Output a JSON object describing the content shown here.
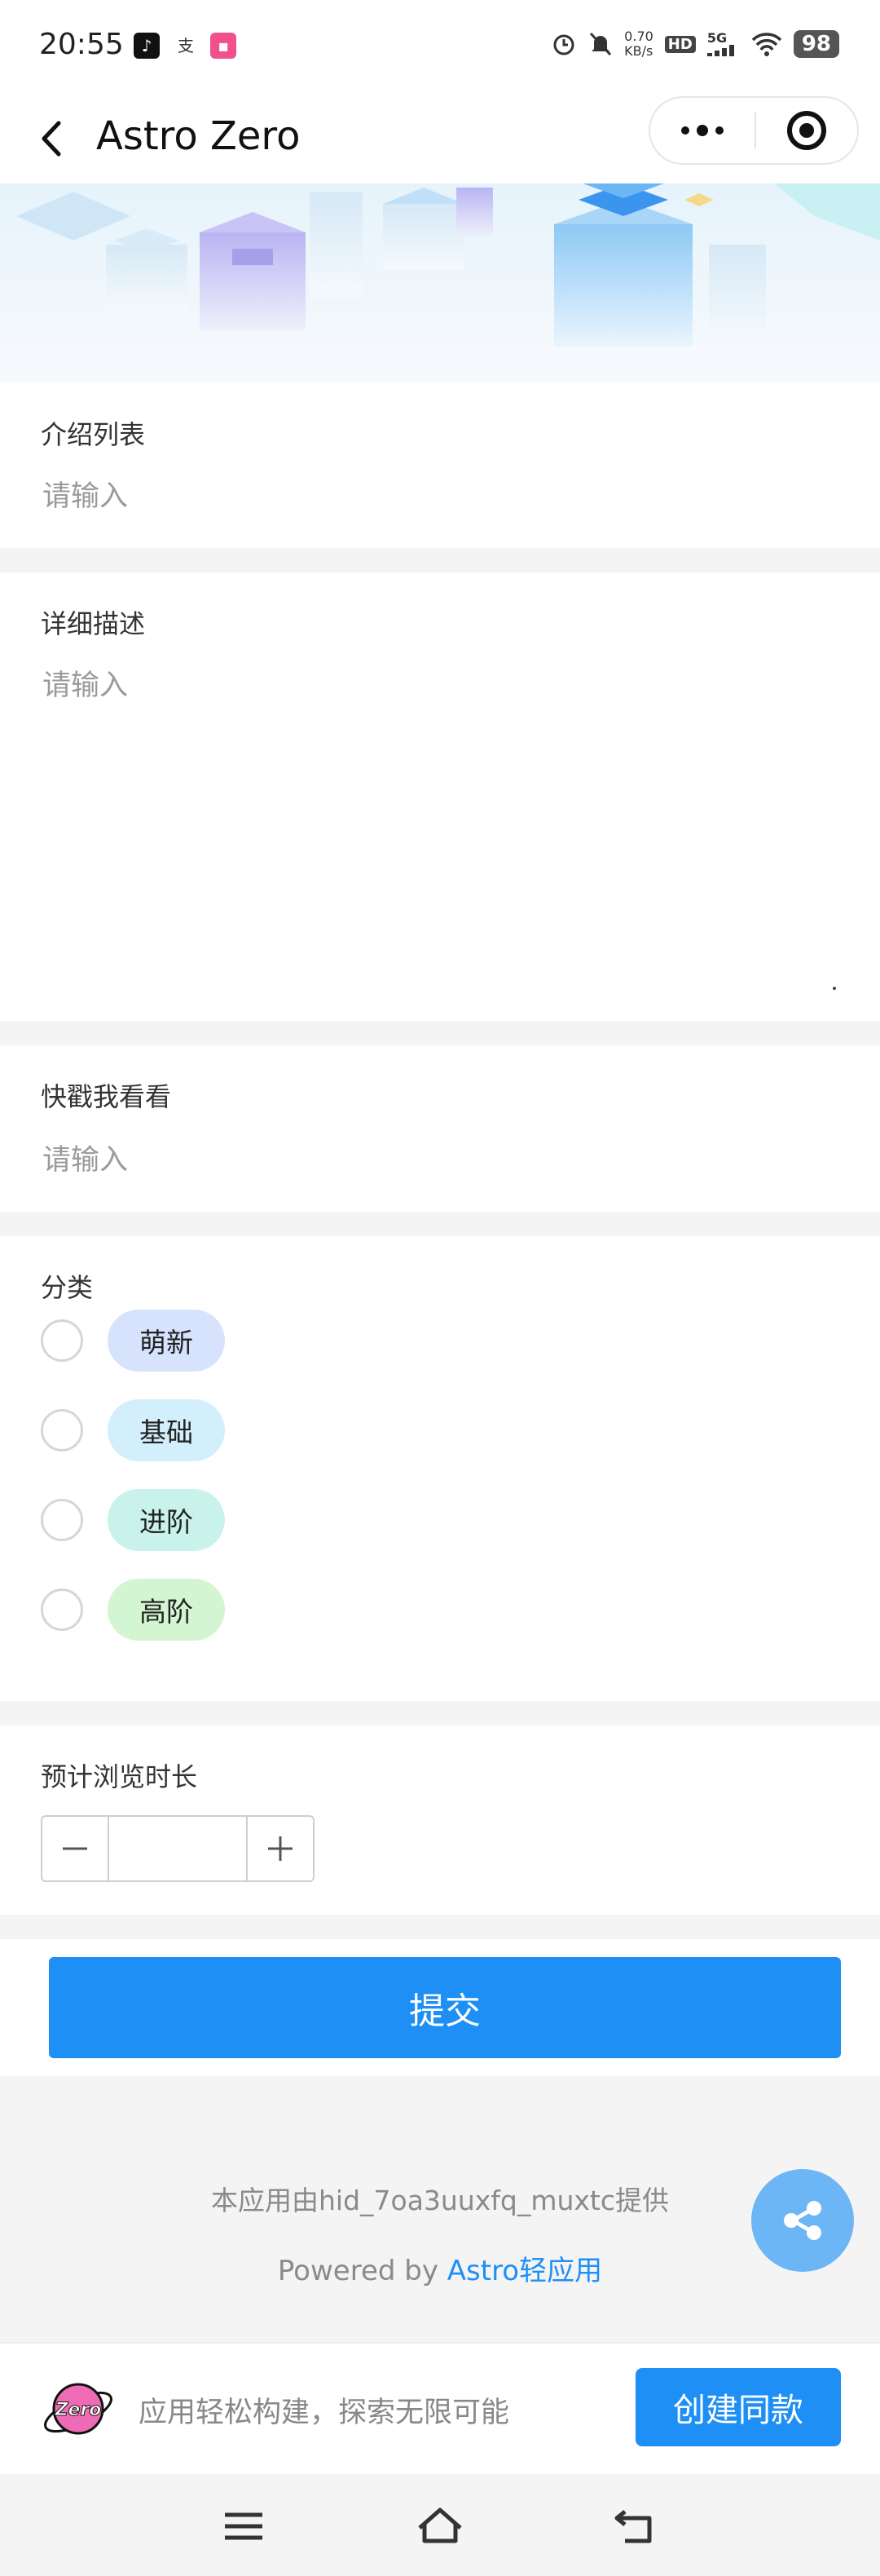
{
  "status_bar": {
    "time": "20:55",
    "network_speed_value": "0.70",
    "network_speed_unit": "KB/s",
    "hd_badge": "HD",
    "network_type": "5G",
    "battery": "98"
  },
  "nav": {
    "title": "Astro Zero"
  },
  "form": {
    "intro_list": {
      "label": "介绍列表",
      "placeholder": "请输入"
    },
    "detail_desc": {
      "label": "详细描述",
      "placeholder": "请输入"
    },
    "quick_look": {
      "label": "快戳我看看",
      "placeholder": "请输入"
    },
    "category": {
      "label": "分类",
      "options": [
        {
          "label": "萌新",
          "color": "#d7e3fc"
        },
        {
          "label": "基础",
          "color": "#d4effc"
        },
        {
          "label": "进阶",
          "color": "#c9f3ea"
        },
        {
          "label": "高阶",
          "color": "#d4f5d2"
        }
      ]
    },
    "duration": {
      "label": "预计浏览时长",
      "value": ""
    },
    "submit_label": "提交"
  },
  "footer": {
    "provider_text": "本应用由hid_7oa3uuxfq_muxtc提供",
    "powered_prefix": "Powered by ",
    "powered_link": "Astro轻应用"
  },
  "promo": {
    "logo_text": "Zero",
    "text": "应用轻松构建，探索无限可能",
    "button_label": "创建同款"
  },
  "colors": {
    "primary": "#1e8ff5",
    "share_button": "#6db6f6"
  }
}
